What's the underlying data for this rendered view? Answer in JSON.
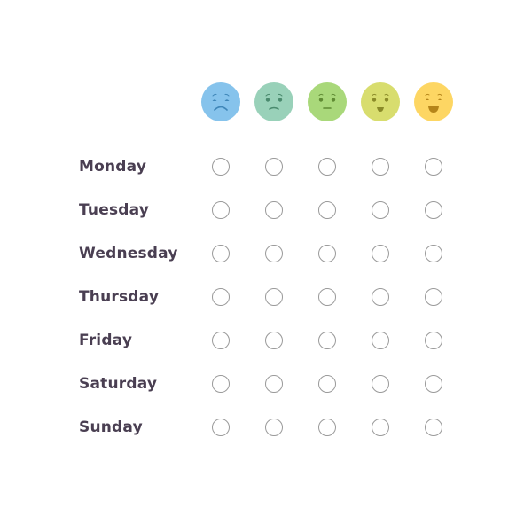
{
  "scale": [
    {
      "name": "very-sad",
      "icon": "very-sad-face-icon",
      "color": "#86c3ec",
      "feature_color": "#3f86b8"
    },
    {
      "name": "sad",
      "icon": "sad-face-icon",
      "color": "#99d1b9",
      "feature_color": "#4a8a6e"
    },
    {
      "name": "neutral",
      "icon": "neutral-face-icon",
      "color": "#a9d87a",
      "feature_color": "#5f8a33"
    },
    {
      "name": "happy",
      "icon": "happy-face-icon",
      "color": "#d8dd6e",
      "feature_color": "#8a8a28"
    },
    {
      "name": "very-happy",
      "icon": "very-happy-face-icon",
      "color": "#fdd663",
      "feature_color": "#b5851a"
    }
  ],
  "rows": [
    {
      "label": "Monday"
    },
    {
      "label": "Tuesday"
    },
    {
      "label": "Wednesday"
    },
    {
      "label": "Thursday"
    },
    {
      "label": "Friday"
    },
    {
      "label": "Saturday"
    },
    {
      "label": "Sunday"
    }
  ]
}
